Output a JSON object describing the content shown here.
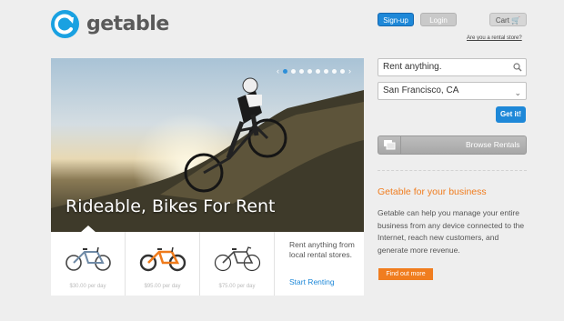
{
  "brand": {
    "name": "getable",
    "accent": "#1aa1e1",
    "orange": "#f07d1f"
  },
  "header": {
    "signup_label": "Sign-up",
    "login_label": "Login",
    "cart_label": "Cart",
    "rental_store_link": "Are you a rental store?"
  },
  "hero": {
    "title": "Rideable, Bikes For Rent",
    "slide_count": 8,
    "active_slide": 1
  },
  "products": [
    {
      "price": "$30.00 per day",
      "icon": "bike-icon"
    },
    {
      "price": "$95.00 per day",
      "icon": "bike-icon"
    },
    {
      "price": "$75.00 per day",
      "icon": "bike-icon"
    }
  ],
  "promo": {
    "text": "Rent anything from local rental stores.",
    "link": "Start Renting"
  },
  "search": {
    "placeholder": "Rent anything.",
    "location": "San Francisco, CA",
    "submit_label": "Get it!"
  },
  "browse": {
    "label": "Browse Rentals"
  },
  "business": {
    "title": "Getable for your business",
    "body": "Getable can help you manage your entire business from any device connected to the Internet, reach new customers, and generate more revenue.",
    "cta": "Find out more"
  }
}
